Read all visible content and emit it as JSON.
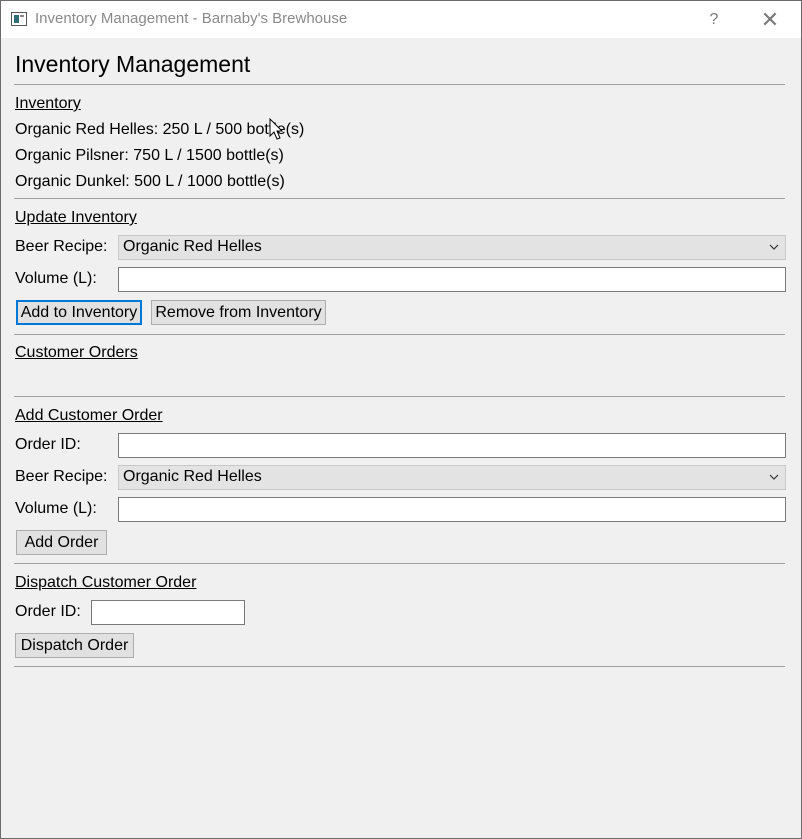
{
  "window": {
    "title": "Inventory Management - Barnaby's Brewhouse",
    "help_glyph": "?",
    "close_glyph": "✕"
  },
  "page": {
    "heading": "Inventory Management"
  },
  "inventory": {
    "title": "Inventory",
    "items": [
      "Organic Red Helles: 250 L / 500 bottle(s)",
      "Organic Pilsner: 750 L / 1500 bottle(s)",
      "Organic Dunkel: 500 L / 1000 bottle(s)"
    ]
  },
  "update_inventory": {
    "title": "Update Inventory",
    "recipe_label": "Beer Recipe:",
    "recipe_value": "Organic Red Helles",
    "volume_label": "Volume (L):",
    "volume_value": "",
    "add_button": "Add to Inventory",
    "remove_button": "Remove from Inventory"
  },
  "customer_orders": {
    "title": "Customer Orders"
  },
  "add_order": {
    "title": "Add Customer Order",
    "order_id_label": "Order ID:",
    "order_id_value": "",
    "recipe_label": "Beer Recipe:",
    "recipe_value": "Organic Red Helles",
    "volume_label": "Volume (L):",
    "volume_value": "",
    "add_button": "Add Order"
  },
  "dispatch_order": {
    "title": "Dispatch Customer Order",
    "order_id_label": "Order ID:",
    "order_id_value": "",
    "dispatch_button": "Dispatch Order"
  },
  "colors": {
    "window_bg": "#f0f0f0",
    "titlebar_bg": "#ffffff",
    "focus_border": "#0078d7",
    "button_bg": "#e1e1e1",
    "combo_bg": "#e3e3e3"
  },
  "icons": {
    "app": "app-icon",
    "help": "help-icon",
    "close": "close-icon",
    "dropdown": "chevron-down-icon",
    "cursor": "mouse-pointer-icon"
  }
}
